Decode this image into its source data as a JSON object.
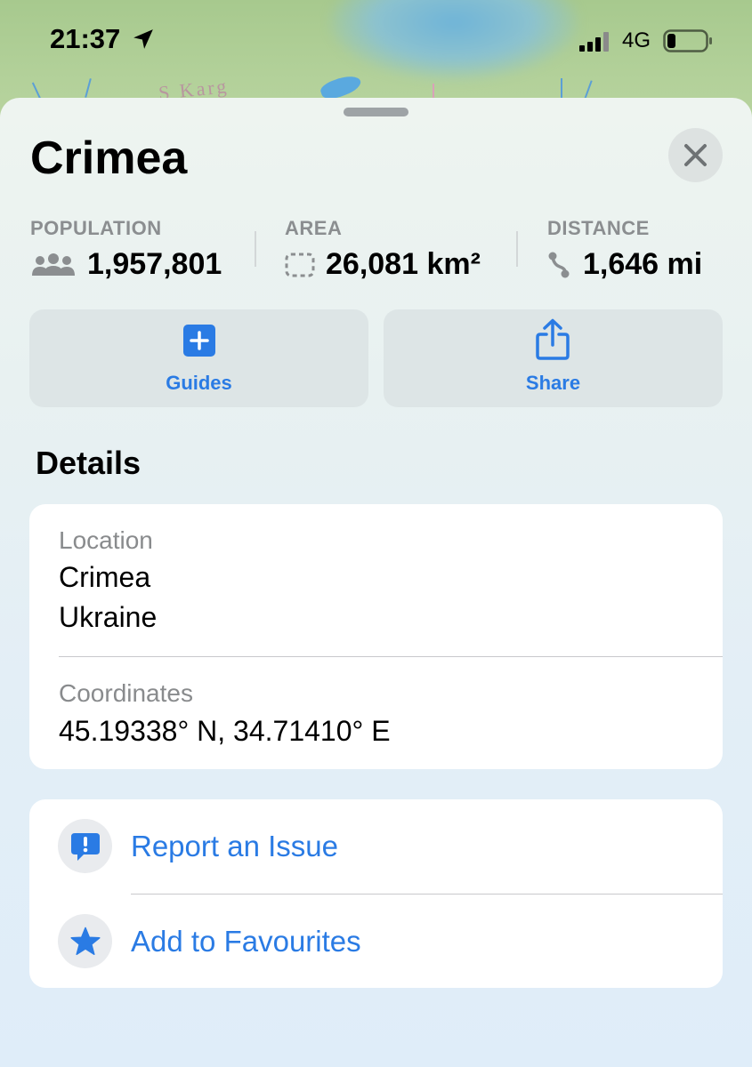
{
  "status_bar": {
    "time": "21:37",
    "network": "4G"
  },
  "map": {
    "label_fragment": "S Karg"
  },
  "place": {
    "title": "Crimea"
  },
  "stats": {
    "population": {
      "label": "POPULATION",
      "value": "1,957,801",
      "icon": "people-icon"
    },
    "area": {
      "label": "AREA",
      "value": "26,081 km²",
      "icon": "area-icon"
    },
    "distance": {
      "label": "DISTANCE",
      "value": "1,646 mi",
      "icon": "route-icon"
    }
  },
  "actions": {
    "guides_label": "Guides",
    "share_label": "Share"
  },
  "details": {
    "section_title": "Details",
    "location_label": "Location",
    "location_line1": "Crimea",
    "location_line2": "Ukraine",
    "coordinates_label": "Coordinates",
    "coordinates_value": "45.19338° N, 34.71410° E"
  },
  "more_actions": {
    "report_label": "Report an Issue",
    "favourites_label": "Add to Favourites"
  },
  "colors": {
    "accent": "#2a7be4",
    "secondary_text": "#8b8e90"
  }
}
